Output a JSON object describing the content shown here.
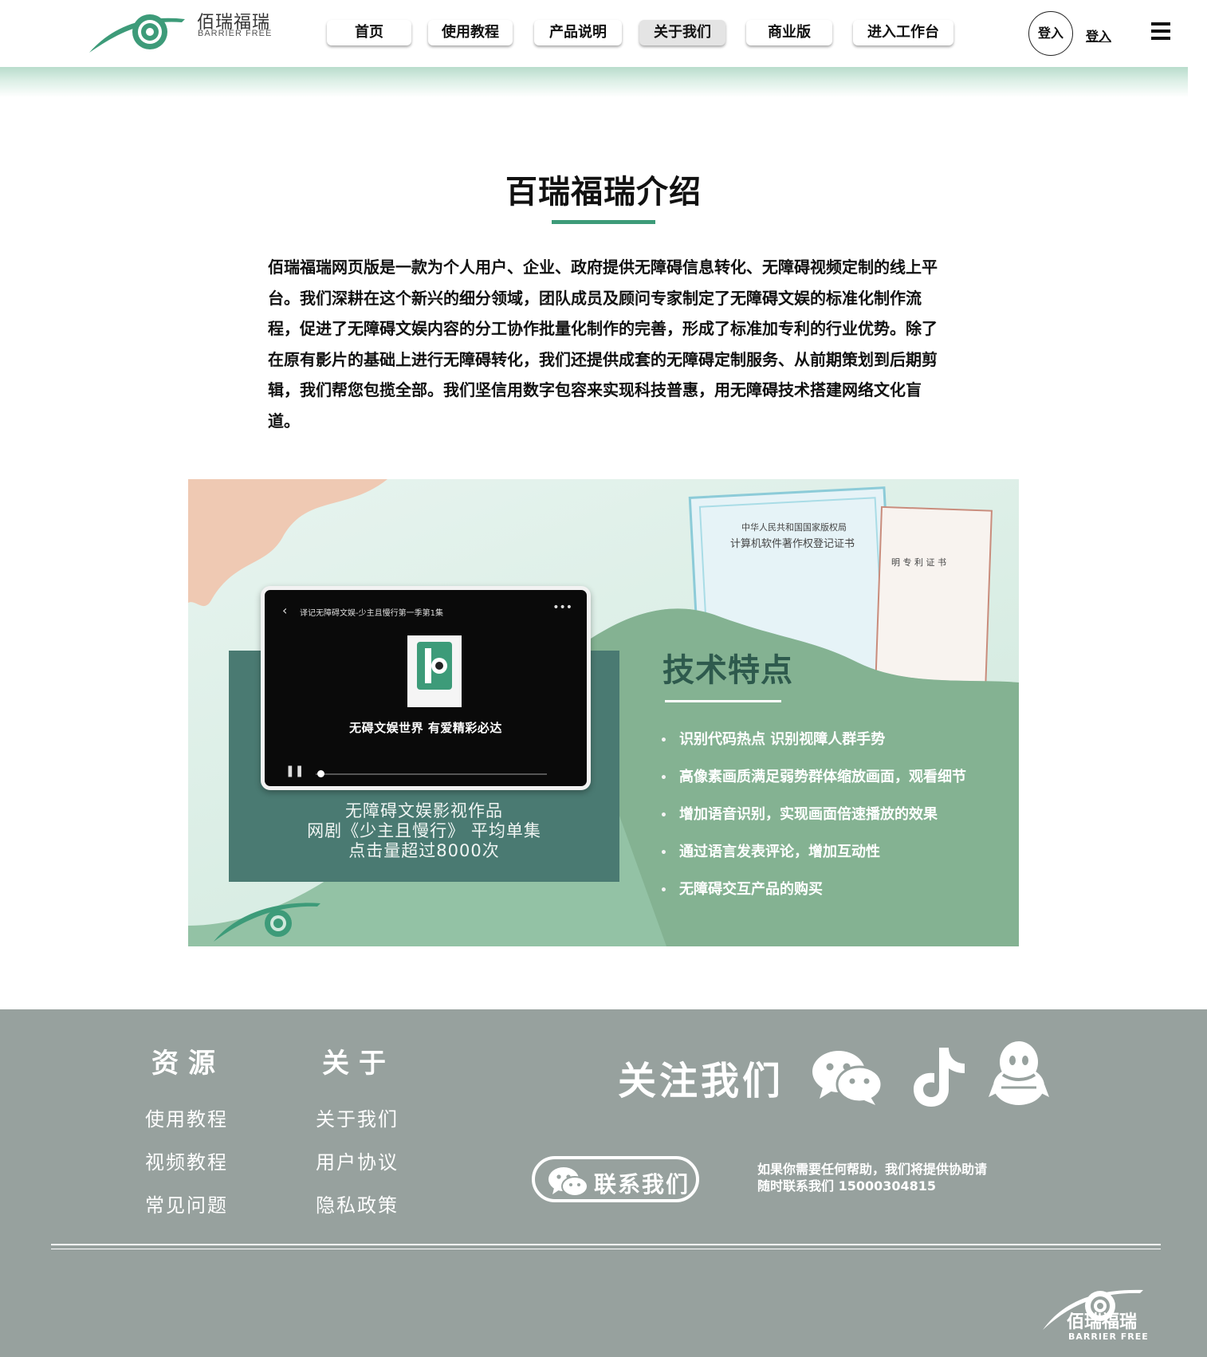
{
  "header": {
    "logo_text": "佰瑞福瑞",
    "logo_sub": "BARRIER FREE",
    "nav": [
      {
        "label": "首页"
      },
      {
        "label": "使用教程"
      },
      {
        "label": "产品说明"
      },
      {
        "label": "关于我们"
      },
      {
        "label": "商业版"
      },
      {
        "label": "进入工作台"
      }
    ],
    "active_nav": "关于我们",
    "login_circle": "登入",
    "login_link": "登入"
  },
  "intro": {
    "title": "百瑞福瑞介绍",
    "paragraph": "佰瑞福瑞网页版是一款为个人用户、企业、政府提供无障碍信息转化、无障碍视频定制的线上平台。我们深耕在这个新兴的细分领域，团队成员及顾问专家制定了无障碍文娱的标准化制作流程，促进了无障碍文娱内容的分工协作批量化制作的完善，形成了标准加专利的行业优势。除了在原有影片的基础上进行无障碍转化，我们还提供成套的无障碍定制服务、从前期策划到后期剪辑，我们帮您包揽全部。我们坚信用数字包容来实现科技普惠，用无障碍技术搭建网络文化盲道。"
  },
  "banner": {
    "tablet_title": "译记无障碍文娱-少主且慢行第一季第1集",
    "tablet_caption": "无碍文娱世界 有爱精彩必达",
    "works": [
      "无障碍文娱影视作品",
      "网剧《少主且慢行》 平均单集",
      "点击量超过8000次"
    ],
    "cert1_title": "中华人民共和国国家版权局",
    "cert1_subtitle": "计算机软件著作权登记证书",
    "cert2_subtitle": "明 专 利 证 书",
    "tech_title": "技术特点",
    "tech_points": [
      "识别代码热点  识别视障人群手势",
      "高像素画质满足弱势群体缩放画面，观看细节",
      "增加语音识别，实现画面倍速播放的效果",
      "通过语言发表评论，增加互动性",
      "无障碍交互产品的购买"
    ]
  },
  "footer": {
    "resources_title": "资源",
    "resources": [
      "使用教程",
      "视频教程",
      "常见问题"
    ],
    "about_title": "关于",
    "about": [
      "关于我们",
      "用户协议",
      "隐私政策"
    ],
    "follow_title": "关注我们",
    "social_icons": [
      "wechat-icon",
      "tiktok-icon",
      "qq-icon"
    ],
    "contact_label": "联系我们",
    "help_line1": "如果你需要任何帮助，我们将提供协助请",
    "help_line2": "随时联系我们 15000304815",
    "logo_text": "佰瑞福瑞",
    "logo_sub": "BARRIER FREE"
  },
  "colors": {
    "brand_green": "#3d9b79",
    "footer_gray": "#97a19e",
    "banner_teal": "#4a7a72"
  }
}
